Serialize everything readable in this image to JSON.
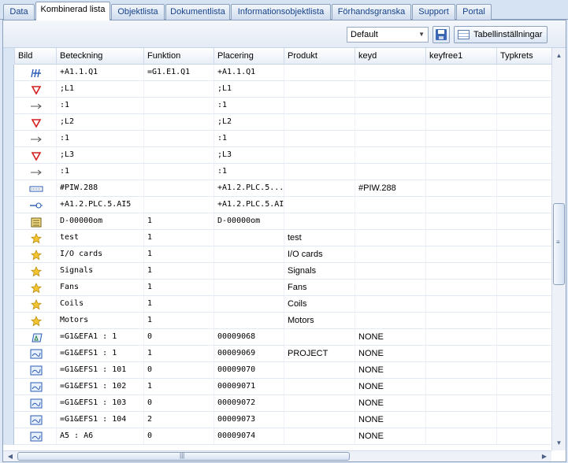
{
  "tabs": [
    "Data",
    "Kombinerad lista",
    "Objektlista",
    "Dokumentlista",
    "Informationsobjektlista",
    "Förhandsgranska",
    "Support",
    "Portal"
  ],
  "active_tab": "Kombinerad lista",
  "toolbar": {
    "layout_select_value": "Default",
    "table_settings_label": "Tabellinställningar"
  },
  "columns": [
    "Bild",
    "Beteckning",
    "Funktion",
    "Placering",
    "Produkt",
    "keyd",
    "keyfree1",
    "Typkrets"
  ],
  "rows": [
    {
      "icon": "terminal-strip-icon",
      "beteckning": "+A1.1.Q1",
      "funktion": "=G1.E1.Q1",
      "placering": "+A1.1.Q1",
      "produkt": "",
      "keyd": ""
    },
    {
      "icon": "red-triangle-icon",
      "beteckning": ";L1",
      "funktion": "",
      "placering": ";L1",
      "produkt": "",
      "keyd": ""
    },
    {
      "icon": "arrow-right-icon",
      "beteckning": ":1",
      "funktion": "",
      "placering": ":1",
      "produkt": "",
      "keyd": ""
    },
    {
      "icon": "red-triangle-icon",
      "beteckning": ";L2",
      "funktion": "",
      "placering": ";L2",
      "produkt": "",
      "keyd": ""
    },
    {
      "icon": "arrow-right-icon",
      "beteckning": ":1",
      "funktion": "",
      "placering": ":1",
      "produkt": "",
      "keyd": ""
    },
    {
      "icon": "red-triangle-icon",
      "beteckning": ";L3",
      "funktion": "",
      "placering": ";L3",
      "produkt": "",
      "keyd": ""
    },
    {
      "icon": "arrow-right-icon",
      "beteckning": ":1",
      "funktion": "",
      "placering": ":1",
      "produkt": "",
      "keyd": ""
    },
    {
      "icon": "signal-box-icon",
      "beteckning": "#PIW.288",
      "funktion": "",
      "placering": "+A1.2.PLC.5....",
      "produkt": "",
      "keyd": "#PIW.288"
    },
    {
      "icon": "connector-arrow-icon",
      "beteckning": "+A1.2.PLC.5.AI5",
      "funktion": "",
      "placering": "+A1.2.PLC.5.AI5",
      "produkt": "",
      "keyd": ""
    },
    {
      "icon": "document-stack-icon",
      "beteckning": "D-00000om",
      "funktion": "1",
      "placering": "D-00000om",
      "produkt": "",
      "keyd": ""
    },
    {
      "icon": "star-icon",
      "beteckning": "test",
      "funktion": "1",
      "placering": "",
      "produkt": "test",
      "keyd": ""
    },
    {
      "icon": "star-icon",
      "beteckning": "I/O cards",
      "funktion": "1",
      "placering": "",
      "produkt": "I/O cards",
      "keyd": ""
    },
    {
      "icon": "star-icon",
      "beteckning": "Signals",
      "funktion": "1",
      "placering": "",
      "produkt": "Signals",
      "keyd": ""
    },
    {
      "icon": "star-icon",
      "beteckning": "Fans",
      "funktion": "1",
      "placering": "",
      "produkt": "Fans",
      "keyd": ""
    },
    {
      "icon": "star-icon",
      "beteckning": "Coils",
      "funktion": "1",
      "placering": "",
      "produkt": "Coils",
      "keyd": ""
    },
    {
      "icon": "star-icon",
      "beteckning": "Motors",
      "funktion": "1",
      "placering": "",
      "produkt": "Motors",
      "keyd": ""
    },
    {
      "icon": "recycle-drawing-icon",
      "beteckning": "=G1&EFA1 : 1",
      "funktion": "0",
      "placering": "00009068",
      "produkt": "",
      "keyd": "NONE"
    },
    {
      "icon": "drawing-sheet-icon",
      "beteckning": "=G1&EFS1 : 1",
      "funktion": "1",
      "placering": "00009069",
      "produkt": "PROJECT",
      "keyd": "NONE"
    },
    {
      "icon": "drawing-sheet-icon",
      "beteckning": "=G1&EFS1 : 101",
      "funktion": "0",
      "placering": "00009070",
      "produkt": "",
      "keyd": "NONE"
    },
    {
      "icon": "drawing-sheet-icon",
      "beteckning": "=G1&EFS1 : 102",
      "funktion": "1",
      "placering": "00009071",
      "produkt": "",
      "keyd": "NONE"
    },
    {
      "icon": "drawing-sheet-icon",
      "beteckning": "=G1&EFS1 : 103",
      "funktion": "0",
      "placering": "00009072",
      "produkt": "",
      "keyd": "NONE"
    },
    {
      "icon": "drawing-sheet-icon",
      "beteckning": "=G1&EFS1 : 104",
      "funktion": "2",
      "placering": "00009073",
      "produkt": "",
      "keyd": "NONE"
    },
    {
      "icon": "drawing-sheet-icon",
      "beteckning": "A5 : A6",
      "funktion": "0",
      "placering": "00009074",
      "produkt": "",
      "keyd": "NONE"
    }
  ]
}
